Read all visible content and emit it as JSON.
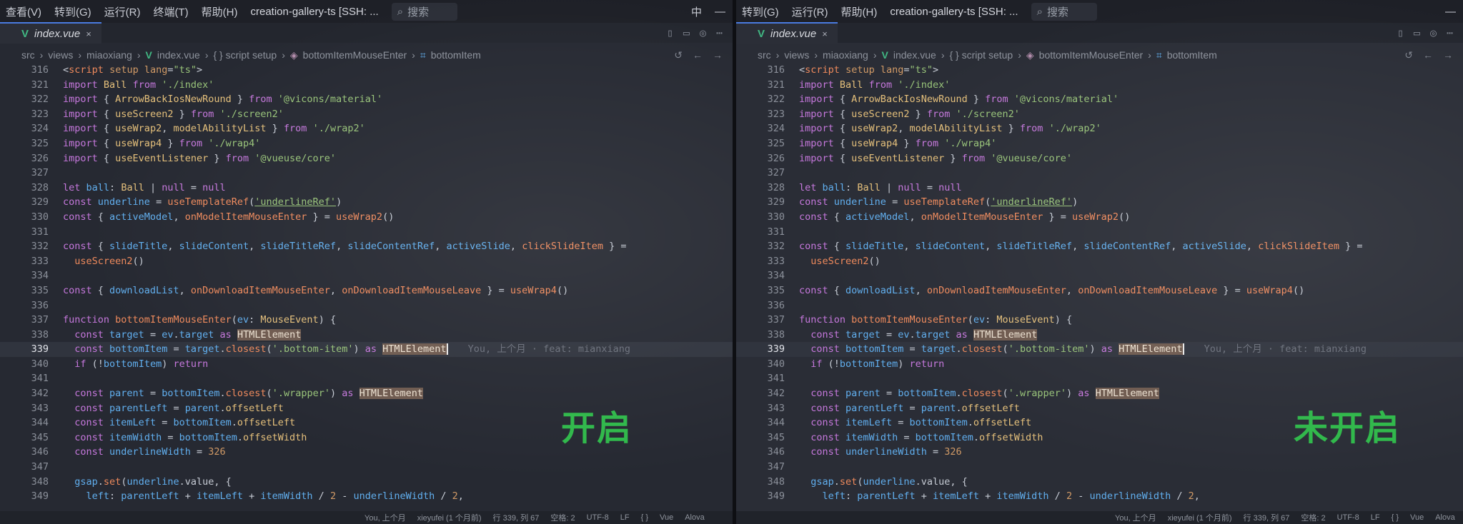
{
  "menu": {
    "items": [
      "查看(V)",
      "转到(G)",
      "运行(R)",
      "终端(T)",
      "帮助(H)"
    ],
    "window_title": "creation-gallery-ts [SSH: ...",
    "search_placeholder": "搜索",
    "ime": "中"
  },
  "tab": {
    "file": "index.vue",
    "vue_badge": "V",
    "close": "×"
  },
  "breadcrumb": [
    "src",
    "views",
    "miaoxiang",
    "index.vue",
    "{ } script setup",
    "bottomItemMouseEnter",
    "bottomItem"
  ],
  "blame_text": "You, 上个月 · feat: mianxiang",
  "labels": {
    "left": "开启",
    "right": "未开启"
  },
  "status": {
    "left": [
      "You, 上个月",
      "xieyufei (1 个月前)",
      "行 339, 列 67",
      "空格: 2",
      "UTF-8",
      "LF",
      "{ }",
      "Vue",
      "Alova"
    ],
    "right": [
      "You, 上个月",
      "xieyufei (1 个月前)",
      "行 339, 列 67",
      "空格: 2",
      "UTF-8",
      "LF",
      "{ }",
      "Vue",
      "Alova"
    ]
  },
  "code": [
    {
      "ln": "316",
      "seg": [
        [
          "",
          "&lt;"
        ],
        [
          "f",
          "script"
        ],
        [
          "",
          " "
        ],
        [
          "n",
          "setup"
        ],
        [
          "",
          " "
        ],
        [
          "n",
          "lang"
        ],
        [
          "",
          "="
        ],
        [
          "s",
          "\"ts\""
        ],
        [
          "",
          "&gt;"
        ]
      ]
    },
    {
      "ln": "321",
      "seg": [
        [
          "k",
          "import"
        ],
        [
          "",
          " "
        ],
        [
          "t",
          "Ball"
        ],
        [
          "",
          " "
        ],
        [
          "k",
          "from"
        ],
        [
          "",
          " "
        ],
        [
          "s",
          "'./index'"
        ]
      ]
    },
    {
      "ln": "322",
      "seg": [
        [
          "k",
          "import"
        ],
        [
          "",
          " { "
        ],
        [
          "t",
          "ArrowBackIosNewRound"
        ],
        [
          "",
          " } "
        ],
        [
          "k",
          "from"
        ],
        [
          "",
          " "
        ],
        [
          "s",
          "'@vicons/material'"
        ]
      ]
    },
    {
      "ln": "323",
      "seg": [
        [
          "k",
          "import"
        ],
        [
          "",
          " { "
        ],
        [
          "t",
          "useScreen2"
        ],
        [
          "",
          " } "
        ],
        [
          "k",
          "from"
        ],
        [
          "",
          " "
        ],
        [
          "s",
          "'./screen2'"
        ]
      ]
    },
    {
      "ln": "324",
      "seg": [
        [
          "k",
          "import"
        ],
        [
          "",
          " { "
        ],
        [
          "t",
          "useWrap2"
        ],
        [
          "",
          ", "
        ],
        [
          "t",
          "modelAbilityList"
        ],
        [
          "",
          " } "
        ],
        [
          "k",
          "from"
        ],
        [
          "",
          " "
        ],
        [
          "s",
          "'./wrap2'"
        ]
      ]
    },
    {
      "ln": "325",
      "seg": [
        [
          "k",
          "import"
        ],
        [
          "",
          " { "
        ],
        [
          "t",
          "useWrap4"
        ],
        [
          "",
          " } "
        ],
        [
          "k",
          "from"
        ],
        [
          "",
          " "
        ],
        [
          "s",
          "'./wrap4'"
        ]
      ]
    },
    {
      "ln": "326",
      "seg": [
        [
          "k",
          "import"
        ],
        [
          "",
          " { "
        ],
        [
          "t",
          "useEventListener"
        ],
        [
          "",
          " } "
        ],
        [
          "k",
          "from"
        ],
        [
          "",
          " "
        ],
        [
          "s",
          "'@vueuse/core'"
        ]
      ]
    },
    {
      "ln": "327",
      "seg": []
    },
    {
      "ln": "328",
      "seg": [
        [
          "k",
          "let"
        ],
        [
          "",
          " "
        ],
        [
          "p",
          "ball"
        ],
        [
          "",
          ": "
        ],
        [
          "t",
          "Ball"
        ],
        [
          "",
          " | "
        ],
        [
          "k",
          "null"
        ],
        [
          "",
          " = "
        ],
        [
          "k",
          "null"
        ]
      ]
    },
    {
      "ln": "329",
      "seg": [
        [
          "k",
          "const"
        ],
        [
          "",
          " "
        ],
        [
          "p",
          "underline"
        ],
        [
          "",
          " = "
        ],
        [
          "f",
          "useTemplateRef"
        ],
        [
          "",
          "("
        ],
        [
          "s u",
          "'underlineRef'"
        ],
        [
          "",
          ")"
        ]
      ]
    },
    {
      "ln": "330",
      "seg": [
        [
          "k",
          "const"
        ],
        [
          "",
          " { "
        ],
        [
          "p",
          "activeModel"
        ],
        [
          "",
          ", "
        ],
        [
          "f",
          "onModelItemMouseEnter"
        ],
        [
          "",
          " } = "
        ],
        [
          "f",
          "useWrap2"
        ],
        [
          "",
          "()"
        ]
      ]
    },
    {
      "ln": "331",
      "seg": []
    },
    {
      "ln": "332",
      "seg": [
        [
          "k",
          "const"
        ],
        [
          "",
          " { "
        ],
        [
          "p",
          "slideTitle"
        ],
        [
          "",
          ", "
        ],
        [
          "p",
          "slideContent"
        ],
        [
          "",
          ", "
        ],
        [
          "p",
          "slideTitleRef"
        ],
        [
          "",
          ", "
        ],
        [
          "p",
          "slideContentRef"
        ],
        [
          "",
          ", "
        ],
        [
          "p",
          "activeSlide"
        ],
        [
          "",
          ", "
        ],
        [
          "f",
          "clickSlideItem"
        ],
        [
          "",
          " } ="
        ]
      ]
    },
    {
      "ln": "333",
      "seg": [
        [
          "",
          "  "
        ],
        [
          "f",
          "useScreen2"
        ],
        [
          "",
          "()"
        ]
      ]
    },
    {
      "ln": "334",
      "seg": []
    },
    {
      "ln": "335",
      "seg": [
        [
          "k",
          "const"
        ],
        [
          "",
          " { "
        ],
        [
          "p",
          "downloadList"
        ],
        [
          "",
          ", "
        ],
        [
          "f",
          "onDownloadItemMouseEnter"
        ],
        [
          "",
          ", "
        ],
        [
          "f",
          "onDownloadItemMouseLeave"
        ],
        [
          "",
          " } = "
        ],
        [
          "f",
          "useWrap4"
        ],
        [
          "",
          "()"
        ]
      ]
    },
    {
      "ln": "336",
      "seg": []
    },
    {
      "ln": "337",
      "seg": [
        [
          "k",
          "function"
        ],
        [
          "",
          " "
        ],
        [
          "f",
          "bottomItemMouseEnter"
        ],
        [
          "",
          "("
        ],
        [
          "p",
          "ev"
        ],
        [
          "",
          ": "
        ],
        [
          "t",
          "MouseEvent"
        ],
        [
          "",
          ") {"
        ]
      ]
    },
    {
      "ln": "338",
      "seg": [
        [
          "",
          "  "
        ],
        [
          "k",
          "const"
        ],
        [
          "",
          " "
        ],
        [
          "p",
          "target"
        ],
        [
          "",
          " = "
        ],
        [
          "p",
          "ev"
        ],
        [
          "",
          "."
        ],
        [
          "p",
          "target"
        ],
        [
          "",
          " "
        ],
        [
          "k",
          "as"
        ],
        [
          "",
          " "
        ],
        [
          "hl",
          "HTMLElement"
        ]
      ]
    },
    {
      "ln": "339",
      "cur": true,
      "seg": [
        [
          "",
          "  "
        ],
        [
          "k",
          "const"
        ],
        [
          "",
          " "
        ],
        [
          "p",
          "bottomItem"
        ],
        [
          "",
          " = "
        ],
        [
          "p",
          "target"
        ],
        [
          "",
          "."
        ],
        [
          "f",
          "closest"
        ],
        [
          "",
          "("
        ],
        [
          "s",
          "'.bottom-item'"
        ],
        [
          "",
          ") "
        ],
        [
          "k",
          "as"
        ],
        [
          "",
          " "
        ],
        [
          "hl",
          "HTMLElement"
        ]
      ]
    },
    {
      "ln": "340",
      "seg": [
        [
          "",
          "  "
        ],
        [
          "k",
          "if"
        ],
        [
          "",
          " (!"
        ],
        [
          "p",
          "bottomItem"
        ],
        [
          "",
          ") "
        ],
        [
          "k",
          "return"
        ]
      ]
    },
    {
      "ln": "341",
      "seg": []
    },
    {
      "ln": "342",
      "seg": [
        [
          "",
          "  "
        ],
        [
          "k",
          "const"
        ],
        [
          "",
          " "
        ],
        [
          "p",
          "parent"
        ],
        [
          "",
          " = "
        ],
        [
          "p",
          "bottomItem"
        ],
        [
          "",
          "."
        ],
        [
          "f",
          "closest"
        ],
        [
          "",
          "("
        ],
        [
          "s",
          "'.wrapper'"
        ],
        [
          "",
          ") "
        ],
        [
          "k",
          "as"
        ],
        [
          "",
          " "
        ],
        [
          "hl",
          "HTMLElement"
        ]
      ]
    },
    {
      "ln": "343",
      "seg": [
        [
          "",
          "  "
        ],
        [
          "k",
          "const"
        ],
        [
          "",
          " "
        ],
        [
          "p",
          "parentLeft"
        ],
        [
          "",
          " = "
        ],
        [
          "p",
          "parent"
        ],
        [
          "",
          "."
        ],
        [
          "t",
          "offsetLeft"
        ]
      ]
    },
    {
      "ln": "344",
      "seg": [
        [
          "",
          "  "
        ],
        [
          "k",
          "const"
        ],
        [
          "",
          " "
        ],
        [
          "p",
          "itemLeft"
        ],
        [
          "",
          " = "
        ],
        [
          "p",
          "bottomItem"
        ],
        [
          "",
          "."
        ],
        [
          "t",
          "offsetLeft"
        ]
      ]
    },
    {
      "ln": "345",
      "seg": [
        [
          "",
          "  "
        ],
        [
          "k",
          "const"
        ],
        [
          "",
          " "
        ],
        [
          "p",
          "itemWidth"
        ],
        [
          "",
          " = "
        ],
        [
          "p",
          "bottomItem"
        ],
        [
          "",
          "."
        ],
        [
          "t",
          "offsetWidth"
        ]
      ]
    },
    {
      "ln": "346",
      "seg": [
        [
          "",
          "  "
        ],
        [
          "k",
          "const"
        ],
        [
          "",
          " "
        ],
        [
          "p",
          "underlineWidth"
        ],
        [
          "",
          " = "
        ],
        [
          "n",
          "326"
        ]
      ]
    },
    {
      "ln": "347",
      "seg": []
    },
    {
      "ln": "348",
      "seg": [
        [
          "",
          "  "
        ],
        [
          "p",
          "gsap"
        ],
        [
          "",
          "."
        ],
        [
          "f",
          "set"
        ],
        [
          "",
          "("
        ],
        [
          "p",
          "underline"
        ],
        [
          "",
          ".value, {"
        ]
      ]
    },
    {
      "ln": "349",
      "seg": [
        [
          "",
          "    "
        ],
        [
          "p",
          "left"
        ],
        [
          "",
          ": "
        ],
        [
          "p",
          "parentLeft"
        ],
        [
          "",
          " + "
        ],
        [
          "p",
          "itemLeft"
        ],
        [
          "",
          " + "
        ],
        [
          "p",
          "itemWidth"
        ],
        [
          "",
          " / "
        ],
        [
          "n",
          "2"
        ],
        [
          "",
          " - "
        ],
        [
          "p",
          "underlineWidth"
        ],
        [
          "",
          " / "
        ],
        [
          "n",
          "2"
        ],
        [
          "",
          ","
        ]
      ]
    }
  ]
}
